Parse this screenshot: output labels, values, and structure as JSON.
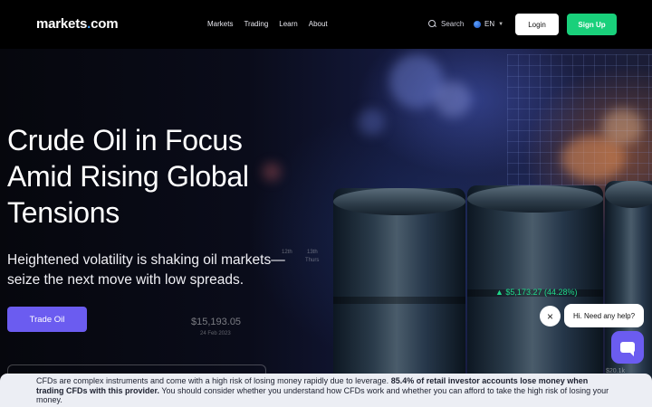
{
  "nav": {
    "logo_text": "markets",
    "logo_dot": ".",
    "logo_suffix": "com",
    "links": [
      "Markets",
      "Trading",
      "Learn",
      "About"
    ],
    "search_label": "Search",
    "language": "EN",
    "login_label": "Login",
    "signup_label": "Sign Up"
  },
  "hero": {
    "title_line1": "Crude Oil in Focus",
    "title_line2": "Amid Rising Global",
    "title_line3": "Tensions",
    "subtitle_line1": "Heightened volatility is shaking oil markets—",
    "subtitle_line2": "seize the next move with low spreads.",
    "cta_label": "Trade Oil"
  },
  "chart_overlays": {
    "price_left": "$15,193.05",
    "date_left": "24 Feb 2023",
    "time_labels": [
      "12th",
      "13th",
      "Thurs"
    ],
    "price_right": "$5,173.27 (44.28%)",
    "price_bottom": "$20.1k"
  },
  "chat": {
    "close_symbol": "×",
    "bubble_text": "Hi. Need any help?"
  },
  "risk_warning": {
    "text_start": "CFDs are complex instruments and come with a high risk of losing money rapidly due to leverage. ",
    "text_bold": "85.4% of retail investor accounts lose money when trading CFDs with this provider.",
    "text_end": " You should consider whether you understand how CFDs work and whether you can afford to take the high risk of losing your money."
  },
  "colors": {
    "accent_purple": "#6b5cf0",
    "signup_green": "#19d07b",
    "price_up_green": "#1fd98a"
  }
}
